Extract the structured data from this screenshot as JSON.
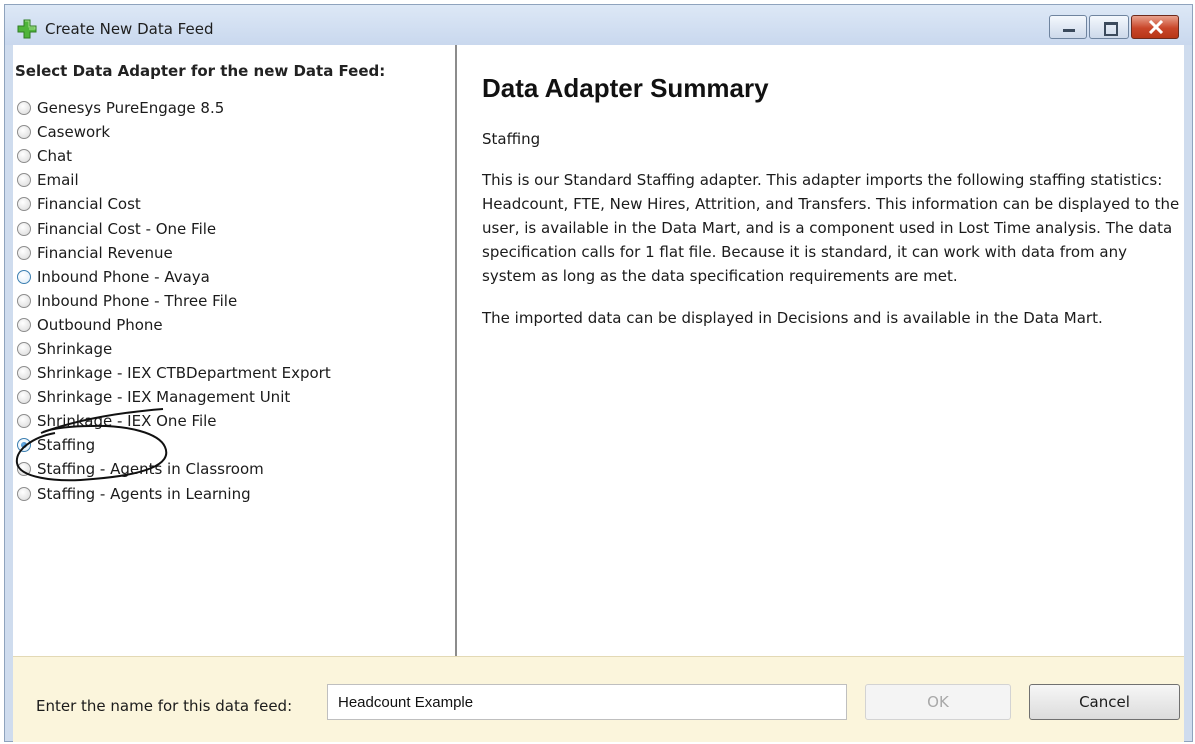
{
  "window": {
    "title": "Create New Data Feed",
    "icon": "green-plus-icon"
  },
  "adapter_list": {
    "header": "Select Data Adapter for the new Data Feed:",
    "items": [
      {
        "label": "Genesys PureEngage 8.5",
        "state": "unchecked"
      },
      {
        "label": "Casework",
        "state": "unchecked"
      },
      {
        "label": "Chat",
        "state": "unchecked"
      },
      {
        "label": "Email",
        "state": "unchecked"
      },
      {
        "label": "Financial Cost",
        "state": "unchecked"
      },
      {
        "label": "Financial Cost - One File",
        "state": "unchecked"
      },
      {
        "label": "Financial Revenue",
        "state": "unchecked"
      },
      {
        "label": "Inbound Phone - Avaya",
        "state": "hover"
      },
      {
        "label": "Inbound Phone - Three File",
        "state": "unchecked"
      },
      {
        "label": "Outbound Phone",
        "state": "unchecked"
      },
      {
        "label": "Shrinkage",
        "state": "unchecked"
      },
      {
        "label": "Shrinkage - IEX CTBDepartment Export",
        "state": "unchecked"
      },
      {
        "label": "Shrinkage - IEX Management Unit",
        "state": "unchecked"
      },
      {
        "label": "Shrinkage - IEX One File",
        "state": "unchecked"
      },
      {
        "label": "Staffing",
        "state": "checked"
      },
      {
        "label": "Staffing - Agents in Classroom",
        "state": "unchecked"
      },
      {
        "label": "Staffing - Agents in Learning",
        "state": "unchecked"
      }
    ]
  },
  "summary": {
    "title": "Data Adapter Summary",
    "adapter_name": "Staffing",
    "description": "This is our Standard Staffing adapter.  This adapter imports the following staffing statistics: Headcount, FTE, New Hires, Attrition, and Transfers.  This information can be displayed to the user, is available in the Data Mart, and is a component used in Lost Time analysis.  The data specification calls for 1 flat file.  Because it is standard, it can work with data from any system as long as the data specification requirements are met.",
    "extra": "The imported data can be displayed in Decisions and is available in the Data Mart."
  },
  "footer": {
    "name_label": "Enter the name for this data feed:",
    "name_value": "Headcount Example",
    "ok_label": "OK",
    "cancel_label": "Cancel"
  },
  "colors": {
    "footer_bg": "#fbf5dc",
    "titlebar_bg": "#cfdcee",
    "close_button": "#c9462a",
    "radio_checked": "#1f5e98"
  }
}
